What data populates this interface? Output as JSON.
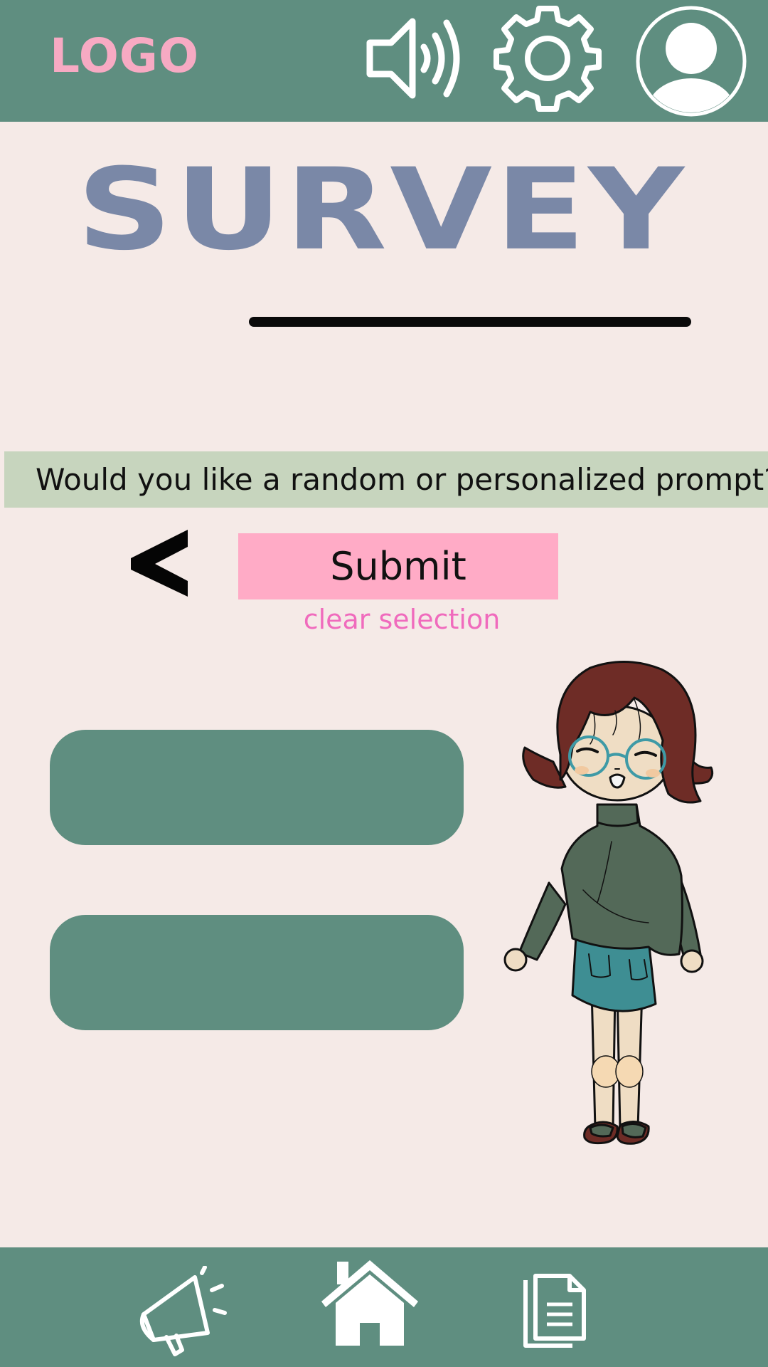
{
  "header": {
    "logo_text": "LOGO",
    "icons": [
      "sound-icon",
      "gear-icon",
      "profile-icon"
    ]
  },
  "main": {
    "title": "SURVEY",
    "prompt_question": "Would you like a random or personalized prompt?",
    "back_label": "<",
    "submit_label": "Submit",
    "clear_label": "clear selection",
    "options": [
      "",
      ""
    ]
  },
  "bottom_nav": {
    "icons": [
      "megaphone-icon",
      "home-icon",
      "document-icon"
    ]
  },
  "colors": {
    "header_bg": "#5f8e80",
    "page_bg": "#f5eae7",
    "logo": "#f7aac3",
    "title": "#7a88a7",
    "banner_bg": "#c7d5be",
    "submit_bg": "#ffabc6",
    "clear_link": "#f06bbd",
    "option_bg": "#5f8e80"
  }
}
